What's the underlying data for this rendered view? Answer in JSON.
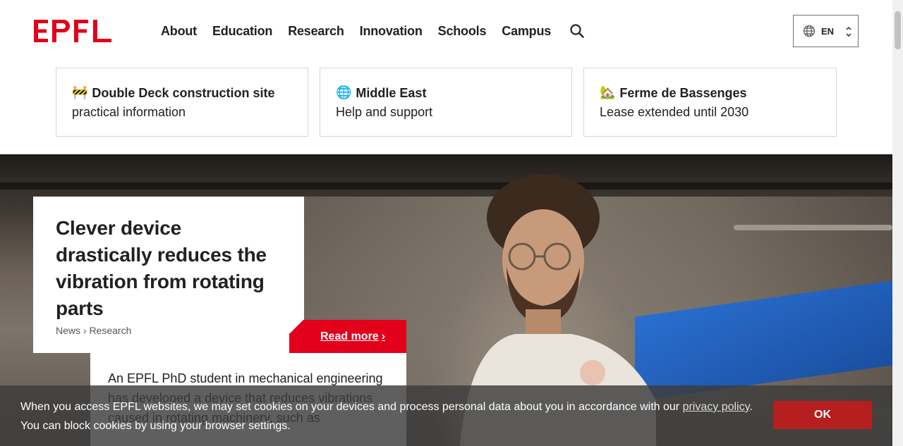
{
  "header": {
    "logo_text": "EPFL",
    "nav": [
      "About",
      "Education",
      "Research",
      "Innovation",
      "Schools",
      "Campus"
    ],
    "search_icon": "search-icon",
    "language": {
      "code": "EN",
      "icon": "globe-icon"
    }
  },
  "quick_links": [
    {
      "emoji": "🚧",
      "title": "Double Deck construction site",
      "subtitle": "practical information"
    },
    {
      "emoji": "🌐",
      "title": "Middle East",
      "subtitle": "Help and support"
    },
    {
      "emoji": "🏡",
      "title": "Ferme de Bassenges",
      "subtitle": "Lease extended until 2030"
    }
  ],
  "hero": {
    "headline": "Clever device drastically reduces the vibration from rotating parts",
    "breadcrumb": "News › Research",
    "read_more": "Read more",
    "summary": "An EPFL PhD student in mechanical engineering has developed a device that reduces vibrations caused in rotating machinery, such as"
  },
  "cookie_banner": {
    "text_before": "When you access EPFL websites, we may set cookies on your devices and process personal data about you in accordance with our ",
    "link": "privacy policy",
    "text_after": ". You can block cookies by using your browser settings.",
    "ok": "OK"
  },
  "colors": {
    "brand_red": "#e2001a",
    "ok_button": "#b51f1f"
  }
}
